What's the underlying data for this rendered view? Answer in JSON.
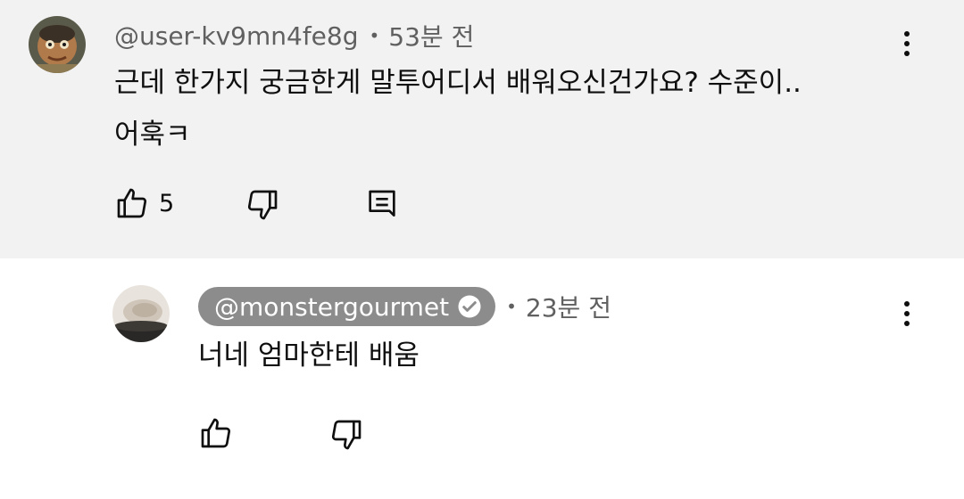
{
  "comment": {
    "author": "@user-kv9mn4fe8g",
    "separator": "•",
    "time": "53분 전",
    "text_line1": "근데 한가지 궁금한게 말투어디서 배워오신건가요? 수준이..",
    "text_line2": "어훅ㅋ",
    "like_count": "5",
    "icons": {
      "more": "more-vertical-icon",
      "like": "thumbs-up-icon",
      "dislike": "thumbs-down-icon",
      "reply": "reply-comment-icon"
    }
  },
  "reply": {
    "author": "@monstergourmet",
    "author_verified": true,
    "separator": "•",
    "time": "23분 전",
    "text": "너네 엄마한테 배움",
    "icons": {
      "more": "more-vertical-icon",
      "like": "thumbs-up-icon",
      "dislike": "thumbs-down-icon",
      "verified": "verified-check-icon"
    }
  },
  "colors": {
    "top_background": "#f2f2f2",
    "reply_background": "#ffffff",
    "meta_text": "#606060",
    "owner_chip": "#8c8c8c"
  }
}
